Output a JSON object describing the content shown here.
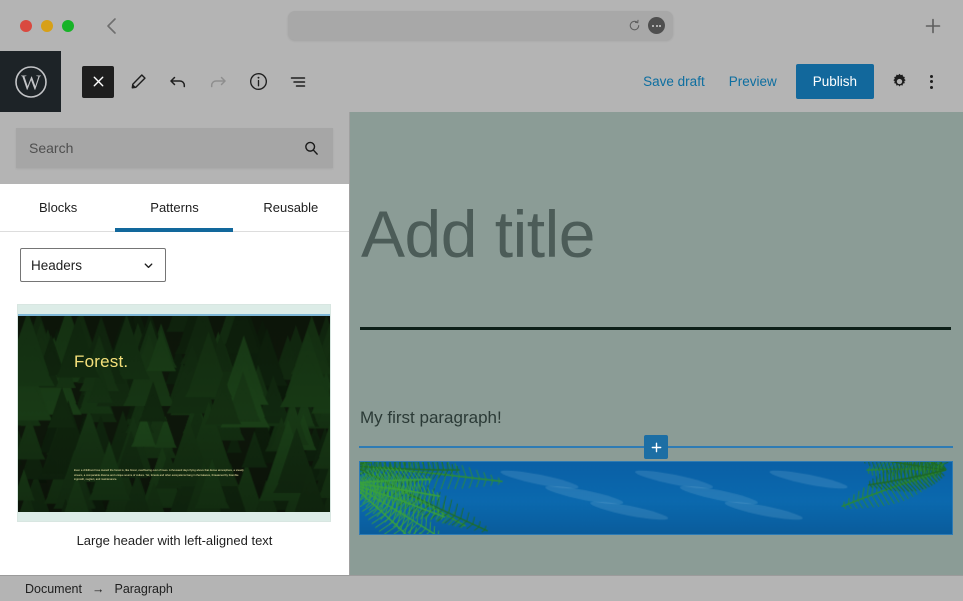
{
  "browser": {
    "address_value": "",
    "address_placeholder": "",
    "back_icon": "chevron-left-icon",
    "reload_icon": "reload-icon",
    "more_icon": "more-options-icon",
    "newtab_icon": "plus-icon",
    "traffic_lights": [
      "close",
      "minimize",
      "zoom"
    ],
    "colors": {
      "red": "#d9493f",
      "yellow": "#d7a017",
      "green": "#17b327"
    }
  },
  "toolbar": {
    "logo_name": "wordpress-logo",
    "close_label": "×",
    "edit_icon": "pencil-icon",
    "undo_icon": "undo-icon",
    "redo_icon": "redo-icon",
    "info_icon": "info-icon",
    "listview_icon": "list-view-icon",
    "save_draft_label": "Save draft",
    "preview_label": "Preview",
    "publish_label": "Publish",
    "settings_icon": "gear-icon",
    "more_icon": "kebab-menu-icon",
    "accent_color": "#12689c",
    "link_color": "#0d6ea0"
  },
  "inserter": {
    "search": {
      "value": "",
      "placeholder": "Search",
      "icon": "search-icon"
    },
    "tabs": [
      {
        "label": "Blocks",
        "active": false
      },
      {
        "label": "Patterns",
        "active": true
      },
      {
        "label": "Reusable",
        "active": false
      }
    ],
    "category_select": {
      "value": "Headers",
      "options": [
        "Headers"
      ],
      "chevron_icon": "chevron-down-icon"
    },
    "patterns": [
      {
        "caption": "Large header with left-aligned text",
        "preview_title": "Forest.",
        "preview_body": "Even a childhood love toward the forest is, like forest, overflowing over of trees. A thousand days flying above that dense atmosphere, a steady stream, a comparable diverse and unique source of culture. Yet, forests and other ecosystems hang in the balance, threatened by bramble ingrowth, neglect, and maintenance.",
        "title_color": "#f4e07a"
      }
    ]
  },
  "editor": {
    "title_placeholder": "Add title",
    "paragraph_text": "My first paragraph!",
    "inserter_plus_label": "+",
    "canvas_bg": "#8b9c96",
    "insertion_line_color": "#2e7bb4"
  },
  "statusbar": {
    "crumbs": [
      "Document",
      "Paragraph"
    ],
    "arrow": "→"
  }
}
